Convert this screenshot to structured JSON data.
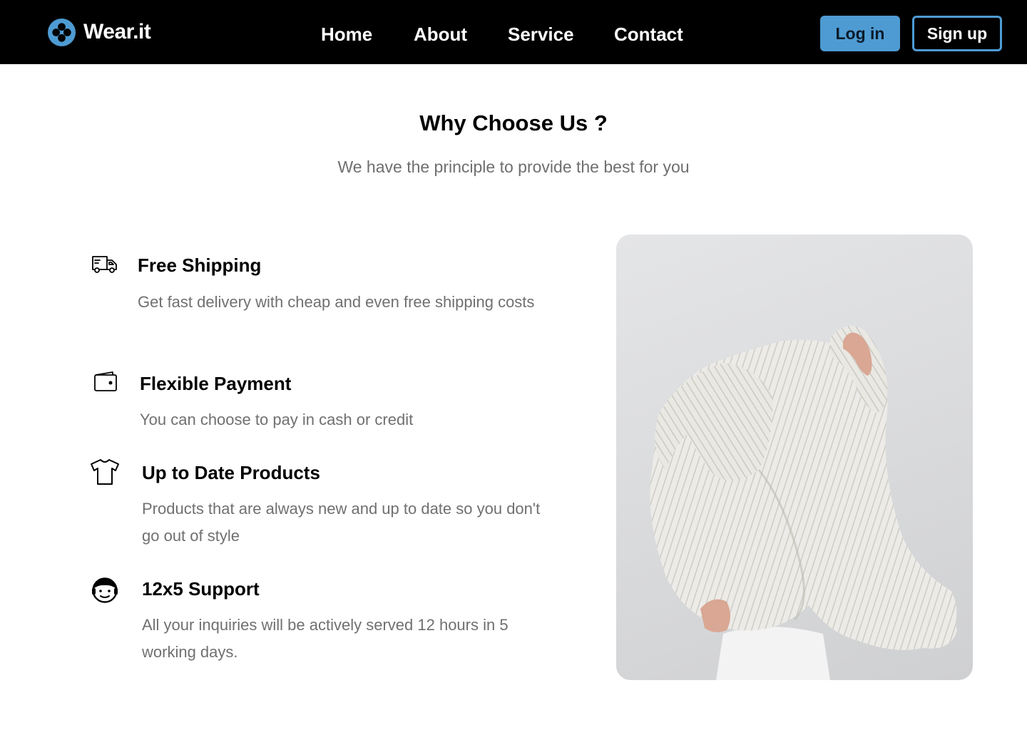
{
  "brand": {
    "name": "Wear.it",
    "logo_icon": "dots-circle-logo-icon",
    "accent_color": "#4e9bd3"
  },
  "nav": {
    "links": [
      "Home",
      "About",
      "Service",
      "Contact"
    ],
    "login_label": "Log in",
    "signup_label": "Sign up"
  },
  "section": {
    "title": "Why Choose Us ?",
    "subtitle": "We have the principle to provide the best for you"
  },
  "features": [
    {
      "icon": "delivery-truck-icon",
      "title": "Free Shipping",
      "description": "Get fast delivery with cheap and even free shipping costs"
    },
    {
      "icon": "wallet-icon",
      "title": "Flexible Payment",
      "description": "You can choose to pay in cash or credit"
    },
    {
      "icon": "t-shirt-icon",
      "title": "Up to Date Products",
      "description": "Products that are always new and up to date so you don't go out of style"
    },
    {
      "icon": "support-agent-icon",
      "title": "12x5 Support",
      "description": "All your inquiries will be actively served 12 hours in 5 working days."
    }
  ],
  "photo": {
    "subject": "person-pulling-knit-sweater-photo"
  }
}
